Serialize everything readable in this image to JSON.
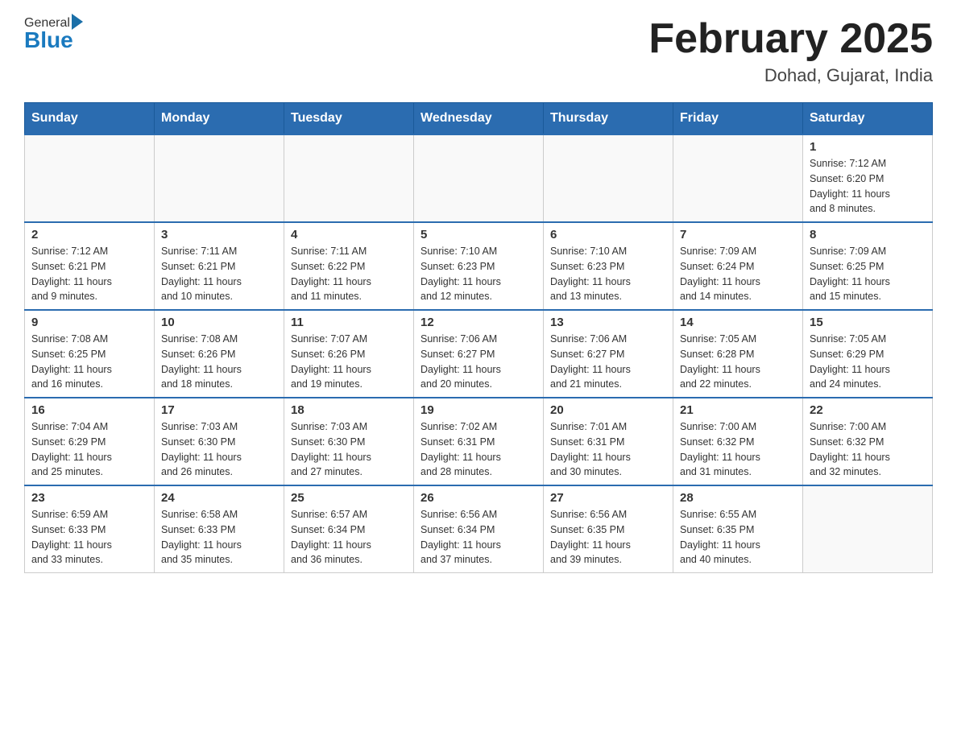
{
  "header": {
    "logo_general": "General",
    "logo_blue": "Blue",
    "title": "February 2025",
    "subtitle": "Dohad, Gujarat, India"
  },
  "days_of_week": [
    "Sunday",
    "Monday",
    "Tuesday",
    "Wednesday",
    "Thursday",
    "Friday",
    "Saturday"
  ],
  "weeks": [
    [
      {
        "day": "",
        "info": ""
      },
      {
        "day": "",
        "info": ""
      },
      {
        "day": "",
        "info": ""
      },
      {
        "day": "",
        "info": ""
      },
      {
        "day": "",
        "info": ""
      },
      {
        "day": "",
        "info": ""
      },
      {
        "day": "1",
        "info": "Sunrise: 7:12 AM\nSunset: 6:20 PM\nDaylight: 11 hours\nand 8 minutes."
      }
    ],
    [
      {
        "day": "2",
        "info": "Sunrise: 7:12 AM\nSunset: 6:21 PM\nDaylight: 11 hours\nand 9 minutes."
      },
      {
        "day": "3",
        "info": "Sunrise: 7:11 AM\nSunset: 6:21 PM\nDaylight: 11 hours\nand 10 minutes."
      },
      {
        "day": "4",
        "info": "Sunrise: 7:11 AM\nSunset: 6:22 PM\nDaylight: 11 hours\nand 11 minutes."
      },
      {
        "day": "5",
        "info": "Sunrise: 7:10 AM\nSunset: 6:23 PM\nDaylight: 11 hours\nand 12 minutes."
      },
      {
        "day": "6",
        "info": "Sunrise: 7:10 AM\nSunset: 6:23 PM\nDaylight: 11 hours\nand 13 minutes."
      },
      {
        "day": "7",
        "info": "Sunrise: 7:09 AM\nSunset: 6:24 PM\nDaylight: 11 hours\nand 14 minutes."
      },
      {
        "day": "8",
        "info": "Sunrise: 7:09 AM\nSunset: 6:25 PM\nDaylight: 11 hours\nand 15 minutes."
      }
    ],
    [
      {
        "day": "9",
        "info": "Sunrise: 7:08 AM\nSunset: 6:25 PM\nDaylight: 11 hours\nand 16 minutes."
      },
      {
        "day": "10",
        "info": "Sunrise: 7:08 AM\nSunset: 6:26 PM\nDaylight: 11 hours\nand 18 minutes."
      },
      {
        "day": "11",
        "info": "Sunrise: 7:07 AM\nSunset: 6:26 PM\nDaylight: 11 hours\nand 19 minutes."
      },
      {
        "day": "12",
        "info": "Sunrise: 7:06 AM\nSunset: 6:27 PM\nDaylight: 11 hours\nand 20 minutes."
      },
      {
        "day": "13",
        "info": "Sunrise: 7:06 AM\nSunset: 6:27 PM\nDaylight: 11 hours\nand 21 minutes."
      },
      {
        "day": "14",
        "info": "Sunrise: 7:05 AM\nSunset: 6:28 PM\nDaylight: 11 hours\nand 22 minutes."
      },
      {
        "day": "15",
        "info": "Sunrise: 7:05 AM\nSunset: 6:29 PM\nDaylight: 11 hours\nand 24 minutes."
      }
    ],
    [
      {
        "day": "16",
        "info": "Sunrise: 7:04 AM\nSunset: 6:29 PM\nDaylight: 11 hours\nand 25 minutes."
      },
      {
        "day": "17",
        "info": "Sunrise: 7:03 AM\nSunset: 6:30 PM\nDaylight: 11 hours\nand 26 minutes."
      },
      {
        "day": "18",
        "info": "Sunrise: 7:03 AM\nSunset: 6:30 PM\nDaylight: 11 hours\nand 27 minutes."
      },
      {
        "day": "19",
        "info": "Sunrise: 7:02 AM\nSunset: 6:31 PM\nDaylight: 11 hours\nand 28 minutes."
      },
      {
        "day": "20",
        "info": "Sunrise: 7:01 AM\nSunset: 6:31 PM\nDaylight: 11 hours\nand 30 minutes."
      },
      {
        "day": "21",
        "info": "Sunrise: 7:00 AM\nSunset: 6:32 PM\nDaylight: 11 hours\nand 31 minutes."
      },
      {
        "day": "22",
        "info": "Sunrise: 7:00 AM\nSunset: 6:32 PM\nDaylight: 11 hours\nand 32 minutes."
      }
    ],
    [
      {
        "day": "23",
        "info": "Sunrise: 6:59 AM\nSunset: 6:33 PM\nDaylight: 11 hours\nand 33 minutes."
      },
      {
        "day": "24",
        "info": "Sunrise: 6:58 AM\nSunset: 6:33 PM\nDaylight: 11 hours\nand 35 minutes."
      },
      {
        "day": "25",
        "info": "Sunrise: 6:57 AM\nSunset: 6:34 PM\nDaylight: 11 hours\nand 36 minutes."
      },
      {
        "day": "26",
        "info": "Sunrise: 6:56 AM\nSunset: 6:34 PM\nDaylight: 11 hours\nand 37 minutes."
      },
      {
        "day": "27",
        "info": "Sunrise: 6:56 AM\nSunset: 6:35 PM\nDaylight: 11 hours\nand 39 minutes."
      },
      {
        "day": "28",
        "info": "Sunrise: 6:55 AM\nSunset: 6:35 PM\nDaylight: 11 hours\nand 40 minutes."
      },
      {
        "day": "",
        "info": ""
      }
    ]
  ]
}
